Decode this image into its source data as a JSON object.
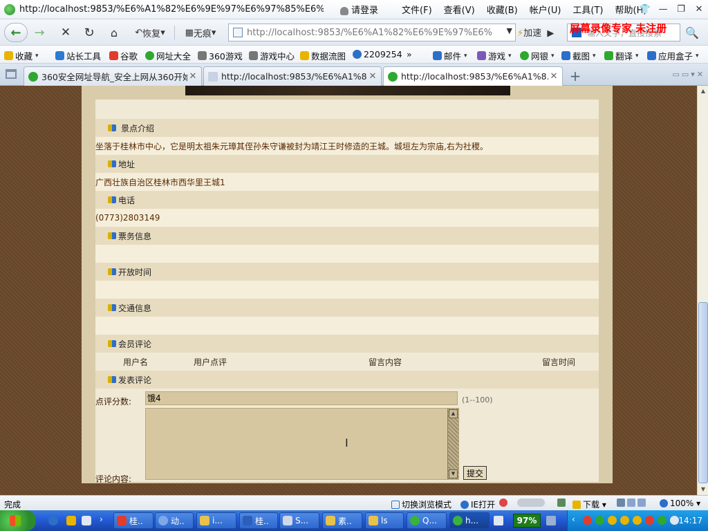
{
  "window": {
    "title": "http://localhost:9853/%E6%A1%82%E6%9E%97%E6%97%85%E6%B8...",
    "menu": [
      "请登录",
      "文件(F)",
      "查看(V)",
      "收藏(B)",
      "帐户(U)",
      "工具(T)",
      "帮助(H)"
    ]
  },
  "nav": {
    "restore_label": "恢复",
    "incognito_label": "无痕",
    "address": "http://localhost:9853/%E6%A1%82%E6%9E%97%E6%",
    "speed_label": "加速",
    "search_placeholder": "输入文字，直接搜索"
  },
  "watermark": "屏幕录像专家 未注册",
  "favorites": [
    {
      "label": "收藏",
      "color": "#e8b400",
      "caret": true
    },
    {
      "label": "站长工具",
      "color": "#2b7bd4",
      "caret": false
    },
    {
      "label": "谷歌",
      "color": "#e23c2c",
      "caret": false
    },
    {
      "label": "网址大全",
      "color": "#2fa82f",
      "caret": false
    },
    {
      "label": "360游戏",
      "color": "#777777",
      "caret": false
    },
    {
      "label": "游戏中心",
      "color": "#777777",
      "caret": false
    },
    {
      "label": "数据流图",
      "color": "#e8b400",
      "caret": false
    },
    {
      "label": "2209254",
      "color": "#2b6fc9",
      "caret": false
    },
    {
      "label": "»",
      "color": "",
      "caret": false
    },
    {
      "label": "邮件",
      "color": "#2b6fc9",
      "caret": true
    },
    {
      "label": "游戏",
      "color": "#7a5ab8",
      "caret": true
    },
    {
      "label": "网银",
      "color": "#2fa82f",
      "caret": true
    },
    {
      "label": "截图",
      "color": "#2b6fc9",
      "caret": true
    },
    {
      "label": "翻译",
      "color": "#2fa82f",
      "caret": true
    },
    {
      "label": "应用盒子",
      "color": "#2b6fc9",
      "caret": true
    }
  ],
  "tabs": [
    {
      "label": "360安全网址导航_安全上网从360开始",
      "active": false
    },
    {
      "label": "http://localhost:9853/%E6%A1%8...",
      "active": false
    },
    {
      "label": "http://localhost:9853/%E6%A1%8...",
      "active": true
    }
  ],
  "page": {
    "sections": {
      "intro_head": "景点介绍",
      "intro_text": "坐落于桂林市中心，它是明太祖朱元璋其侄孙朱守谦被封为靖江王时修造的王城。城垣左为宗庙,右为社稷。",
      "address_head": "地址",
      "address_text": "广西壮族自治区桂林市西华里王城1",
      "phone_head": "电话",
      "phone_text": "(0773)2803149",
      "ticket_head": "票务信息",
      "ticket_text": "",
      "hours_head": "开放时间",
      "hours_text": "",
      "traffic_head": "交通信息",
      "traffic_text": "",
      "reviews_head": "会员评论",
      "post_head": "发表评论"
    },
    "review_columns": [
      "用户名",
      "用户点评",
      "留言内容",
      "留言时间"
    ],
    "form": {
      "score_label": "点评分数:",
      "score_value": "饿4",
      "score_hint": "(1--100)",
      "comment_label": "评论内容:",
      "comment_value": "",
      "submit_label": "提交"
    }
  },
  "status": {
    "text": "完成",
    "compat_mode": "切换浏览模式",
    "ie_open": "IE打开",
    "download": "下载",
    "zoom": "100%"
  },
  "taskbar": {
    "tasks": [
      "桂..",
      "动..",
      "i...",
      "桂..",
      "S...",
      "素..",
      "ls",
      "Q...",
      "h..."
    ],
    "percent": "97%",
    "clock": "14:17"
  }
}
